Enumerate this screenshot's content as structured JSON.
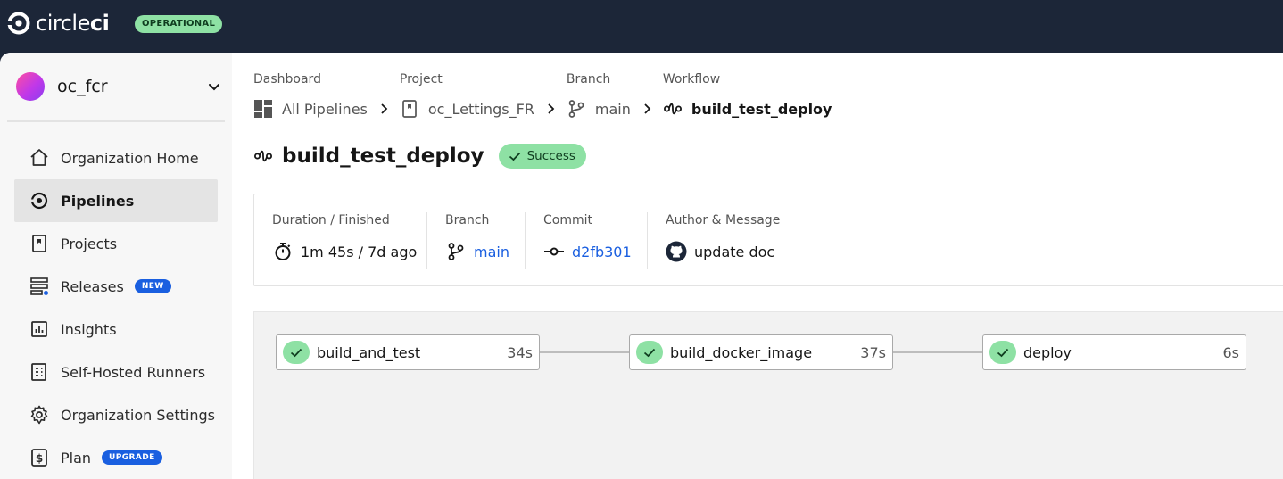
{
  "topbar": {
    "logo_text_light": "circle",
    "logo_text_bold": "ci",
    "status": "OPERATIONAL"
  },
  "sidebar": {
    "org_name": "oc_fcr",
    "items": [
      {
        "label": "Organization Home",
        "icon": "home-icon",
        "active": false
      },
      {
        "label": "Pipelines",
        "icon": "pipelines-icon",
        "active": true
      },
      {
        "label": "Projects",
        "icon": "projects-icon",
        "active": false
      },
      {
        "label": "Releases",
        "icon": "releases-icon",
        "active": false,
        "badge": "NEW"
      },
      {
        "label": "Insights",
        "icon": "insights-icon",
        "active": false
      },
      {
        "label": "Self-Hosted Runners",
        "icon": "runners-icon",
        "active": false
      },
      {
        "label": "Organization Settings",
        "icon": "gear-icon",
        "active": false
      },
      {
        "label": "Plan",
        "icon": "dollar-icon",
        "active": false,
        "badge": "UPGRADE"
      }
    ]
  },
  "breadcrumb": {
    "dashboard": {
      "label": "Dashboard",
      "value": "All Pipelines"
    },
    "project": {
      "label": "Project",
      "value": "oc_Lettings_FR"
    },
    "branch": {
      "label": "Branch",
      "value": "main"
    },
    "workflow": {
      "label": "Workflow",
      "value": "build_test_deploy"
    }
  },
  "workflow": {
    "title": "build_test_deploy",
    "status": "Success"
  },
  "meta": {
    "duration": {
      "label": "Duration / Finished",
      "value": "1m 45s / 7d ago"
    },
    "branch": {
      "label": "Branch",
      "value": "main"
    },
    "commit": {
      "label": "Commit",
      "value": "d2fb301"
    },
    "author": {
      "label": "Author & Message",
      "value": "update doc"
    }
  },
  "jobs": [
    {
      "name": "build_and_test",
      "duration": "34s",
      "status": "success"
    },
    {
      "name": "build_docker_image",
      "duration": "37s",
      "status": "success"
    },
    {
      "name": "deploy",
      "duration": "6s",
      "status": "success"
    }
  ],
  "colors": {
    "topbar": "#1c2638",
    "success": "#8ee1a4",
    "link": "#1a5fe0",
    "badge": "#1a5fe0"
  }
}
